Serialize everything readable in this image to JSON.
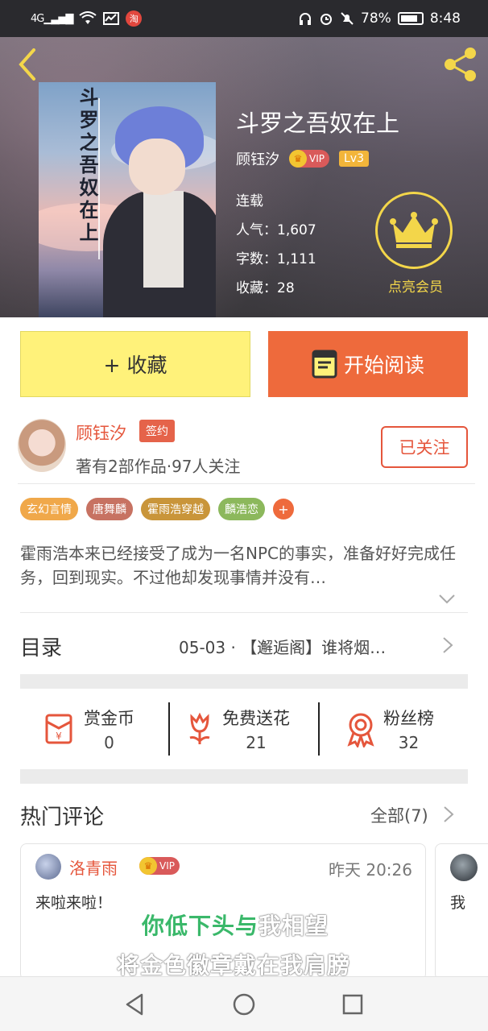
{
  "status_bar": {
    "network": "4G",
    "notification_badge": "淘",
    "battery": "78%",
    "time": "8:48"
  },
  "header": {
    "cover_title": "斗罗之吾奴在上",
    "book_title": "斗罗之吾奴在上",
    "author": "顾钰汐",
    "vip_label": "VIP",
    "level": "Lv3",
    "status": "连载",
    "popularity": "人气：1,607",
    "word_count": "字数：1,111",
    "favorites": "收藏：28",
    "vip_member_label": "点亮会员"
  },
  "actions": {
    "collect_label": "+ 收藏",
    "read_label": "开始阅读"
  },
  "author_section": {
    "name": "顾钰汐",
    "sign_badge": "签约",
    "stats": "著有2部作品·97人关注",
    "follow_label": "已关注"
  },
  "tags": [
    {
      "label": "玄幻言情",
      "color": "#f0a84a"
    },
    {
      "label": "唐舞麟",
      "color": "#c77262"
    },
    {
      "label": "霍雨浩穿越",
      "color": "#c9953a"
    },
    {
      "label": "麟浩恋",
      "color": "#8cb85c"
    }
  ],
  "tag_more": "+",
  "description": "霍雨浩本来已经接受了成为一名NPC的事实，准备好好完成任务，回到现实。不过他却发现事情并没有…",
  "toc": {
    "title": "目录",
    "latest": "05-03 · 【邂逅阁】谁将烟…"
  },
  "stats": {
    "reward_label": "赏金币",
    "reward_value": "0",
    "flower_label": "免费送花",
    "flower_value": "21",
    "fans_label": "粉丝榜",
    "fans_value": "32"
  },
  "hot_comments": {
    "title": "热门评论",
    "all_label": "全部(7)",
    "items": [
      {
        "user": "洛青雨",
        "vip": "VIP",
        "time": "昨天 20:26",
        "text": "来啦来啦！"
      },
      {
        "text": "我"
      }
    ]
  },
  "lyrics": {
    "line1_highlight": "你低下头与",
    "line1_rest": "我相望",
    "line2": "将金色徽章戴在我肩膀"
  },
  "colors": {
    "accent_orange": "#ee6a3c",
    "collect_yellow": "#fff27a",
    "vip_gold": "#f3d64a",
    "author_red": "#e5563c"
  }
}
